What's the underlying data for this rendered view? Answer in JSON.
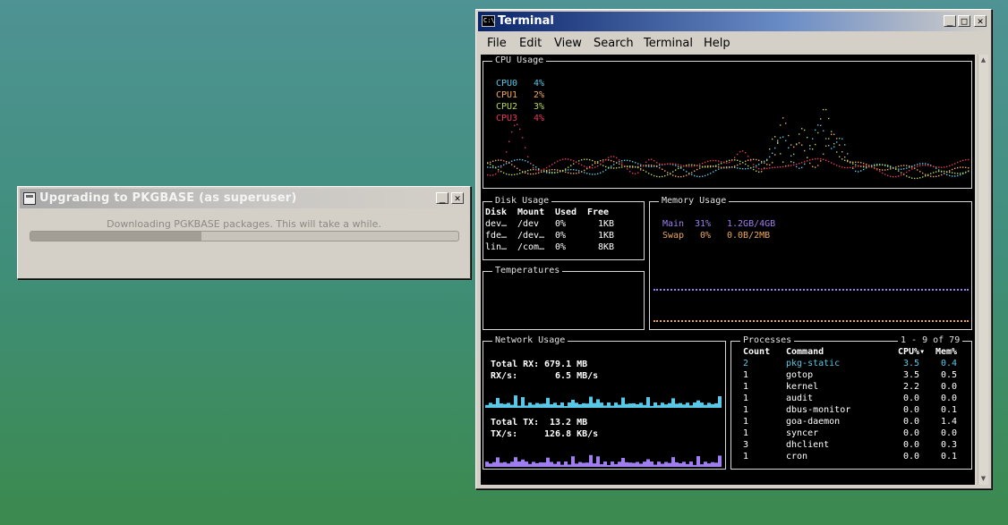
{
  "dialog": {
    "title": "Upgrading to PKGBASE (as superuser)",
    "message": "Downloading PGKBASE packages. This will take a while.",
    "progress": 0.4,
    "minimize_label": "_",
    "close_label": "✕"
  },
  "terminal": {
    "title": "Terminal",
    "minimize_label": "_",
    "maximize_label": "□",
    "close_label": "✕",
    "menu": [
      "File",
      "Edit",
      "View",
      "Search",
      "Terminal",
      "Help"
    ]
  },
  "cpu": {
    "title": "CPU Usage",
    "cores": [
      {
        "name": "CPU0",
        "value": "4%",
        "color": "#59c8e6"
      },
      {
        "name": "CPU1",
        "value": "2%",
        "color": "#f2a75b"
      },
      {
        "name": "CPU2",
        "value": "3%",
        "color": "#b6d84d"
      },
      {
        "name": "CPU3",
        "value": "4%",
        "color": "#e8365e"
      }
    ]
  },
  "disk": {
    "title": "Disk Usage",
    "headers": [
      "Disk",
      "Mount",
      "Used",
      "Free"
    ],
    "rows": [
      [
        "dev…",
        "/dev",
        "0%",
        "1KB"
      ],
      [
        "fde…",
        "/dev…",
        "0%",
        "1KB"
      ],
      [
        "lin…",
        "/com…",
        "0%",
        "8KB"
      ]
    ]
  },
  "memory": {
    "title": "Memory Usage",
    "main": {
      "label": "Main",
      "percent": "31%",
      "amount": "1.2GB/4GB",
      "color": "#9f7ef0"
    },
    "swap": {
      "label": "Swap",
      "percent": "0%",
      "amount": "0.0B/2MB",
      "color": "#e9a75b"
    }
  },
  "temperatures": {
    "title": "Temperatures"
  },
  "network": {
    "title": "Network Usage",
    "rx_total_label": "Total RX:",
    "rx_total": "679.1 MB",
    "rx_rate_label": "RX/s:",
    "rx_rate": "6.5 MB/s",
    "tx_total_label": "Total TX:",
    "tx_total": "13.2 MB",
    "tx_rate_label": "TX/s:",
    "tx_rate": "126.8 KB/s",
    "rx_color": "#59c8e6",
    "tx_color": "#9f7ef0"
  },
  "processes": {
    "title": "Processes",
    "range": "1 - 9 of 79",
    "headers": [
      "Count",
      "Command",
      "CPU%▾",
      "Mem%"
    ],
    "rows": [
      [
        "2",
        "pkg-static",
        "3.5",
        "0.4"
      ],
      [
        "1",
        "gotop",
        "3.5",
        "0.5"
      ],
      [
        "1",
        "kernel",
        "2.2",
        "0.0"
      ],
      [
        "1",
        "audit",
        "0.0",
        "0.0"
      ],
      [
        "1",
        "dbus-monitor",
        "0.0",
        "0.1"
      ],
      [
        "1",
        "goa-daemon",
        "0.0",
        "1.4"
      ],
      [
        "1",
        "syncer",
        "0.0",
        "0.0"
      ],
      [
        "3",
        "dhclient",
        "0.0",
        "0.3"
      ],
      [
        "1",
        "cron",
        "0.0",
        "0.1"
      ]
    ],
    "highlight_color": "#59c8e6"
  }
}
